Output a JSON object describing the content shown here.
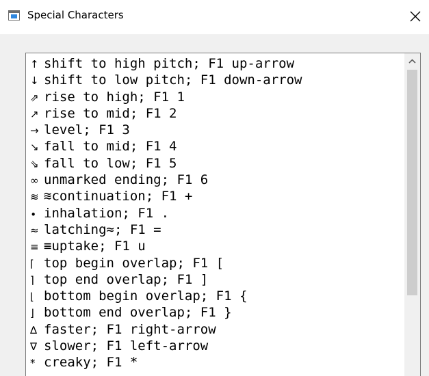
{
  "window": {
    "title": "Special Characters",
    "close_glyph": "✕"
  },
  "list": {
    "items": [
      {
        "symbol": "↑",
        "label": "shift to high pitch; F1 up-arrow"
      },
      {
        "symbol": "↓",
        "label": "shift to low pitch; F1 down-arrow"
      },
      {
        "symbol": "⇗",
        "label": "rise to high; F1 1"
      },
      {
        "symbol": "↗",
        "label": "rise to mid; F1 2"
      },
      {
        "symbol": "→",
        "label": "level; F1 3"
      },
      {
        "symbol": "↘",
        "label": "fall to mid; F1 4"
      },
      {
        "symbol": "⇘",
        "label": "fall to low; F1 5"
      },
      {
        "symbol": "∞",
        "label": "unmarked ending; F1 6"
      },
      {
        "symbol": "≋",
        "label": "≋continuation; F1 +"
      },
      {
        "symbol": "∙",
        "label": "inhalation; F1 ."
      },
      {
        "symbol": "≈",
        "label": "latching≈; F1 ="
      },
      {
        "symbol": "≡",
        "label": "≡uptake; F1 u"
      },
      {
        "symbol": "⌈",
        "label": "top begin overlap; F1 ["
      },
      {
        "symbol": "⌉",
        "label": "top end overlap; F1 ]"
      },
      {
        "symbol": "⌊",
        "label": "bottom begin overlap; F1 {"
      },
      {
        "symbol": "⌋",
        "label": "bottom end overlap; F1 }"
      },
      {
        "symbol": "∆",
        "label": "faster; F1 right-arrow"
      },
      {
        "symbol": "∇",
        "label": "slower; F1 left-arrow"
      },
      {
        "symbol": "*",
        "label": "creaky; F1 *"
      }
    ]
  },
  "scrollbar": {
    "up_icon": "chevron-up-icon"
  }
}
